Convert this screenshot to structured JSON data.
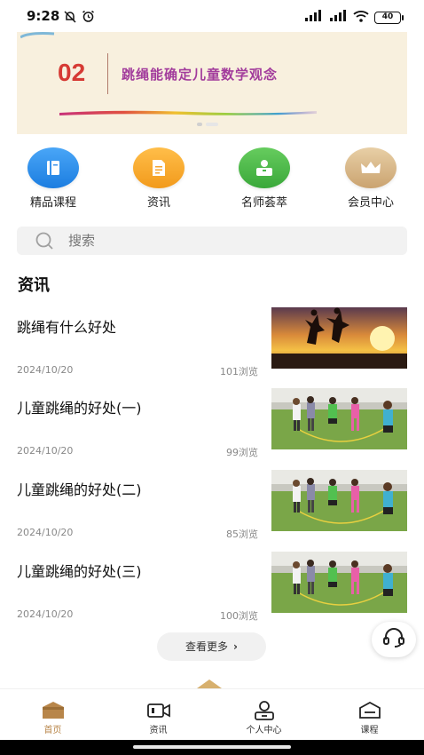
{
  "status_bar": {
    "time": "9:28",
    "battery": "40"
  },
  "banner": {
    "number": "02",
    "title": "跳绳能确定儿童数学观念"
  },
  "quick_links": [
    {
      "label": "精品课程",
      "icon": "book-icon",
      "color": "#2f8ef0"
    },
    {
      "label": "资讯",
      "icon": "document-icon",
      "color": "#f5a430"
    },
    {
      "label": "名师荟萃",
      "icon": "teacher-icon",
      "color": "#4bb64b"
    },
    {
      "label": "会员中心",
      "icon": "crown-icon",
      "color": "#d9b98a"
    }
  ],
  "search": {
    "placeholder": "搜索"
  },
  "section": {
    "title": "资讯"
  },
  "news": [
    {
      "title": "跳绳有什么好处",
      "date": "2024/10/20",
      "views": "101浏览",
      "thumb": "sunset-jump-photo"
    },
    {
      "title": "儿童跳绳的好处(一)",
      "date": "2024/10/20",
      "views": "99浏览",
      "thumb": "kids-jumprope-photo"
    },
    {
      "title": "儿童跳绳的好处(二)",
      "date": "2024/10/20",
      "views": "85浏览",
      "thumb": "kids-jumprope-photo"
    },
    {
      "title": "儿童跳绳的好处(三)",
      "date": "2024/10/20",
      "views": "100浏览",
      "thumb": "kids-jumprope-photo"
    }
  ],
  "more": {
    "label": "查看更多",
    "arrow": "›"
  },
  "tabs": [
    {
      "label": "首页",
      "icon": "home-icon",
      "active": true
    },
    {
      "label": "资讯",
      "icon": "video-icon",
      "active": false
    },
    {
      "label": "个人中心",
      "icon": "person-icon",
      "active": false
    },
    {
      "label": "课程",
      "icon": "course-icon",
      "active": false
    }
  ],
  "colors": {
    "accent": "#b8864a",
    "banner_bg": "#f8f0de",
    "banner_number": "#d63a34",
    "banner_title": "#a23c9c"
  }
}
